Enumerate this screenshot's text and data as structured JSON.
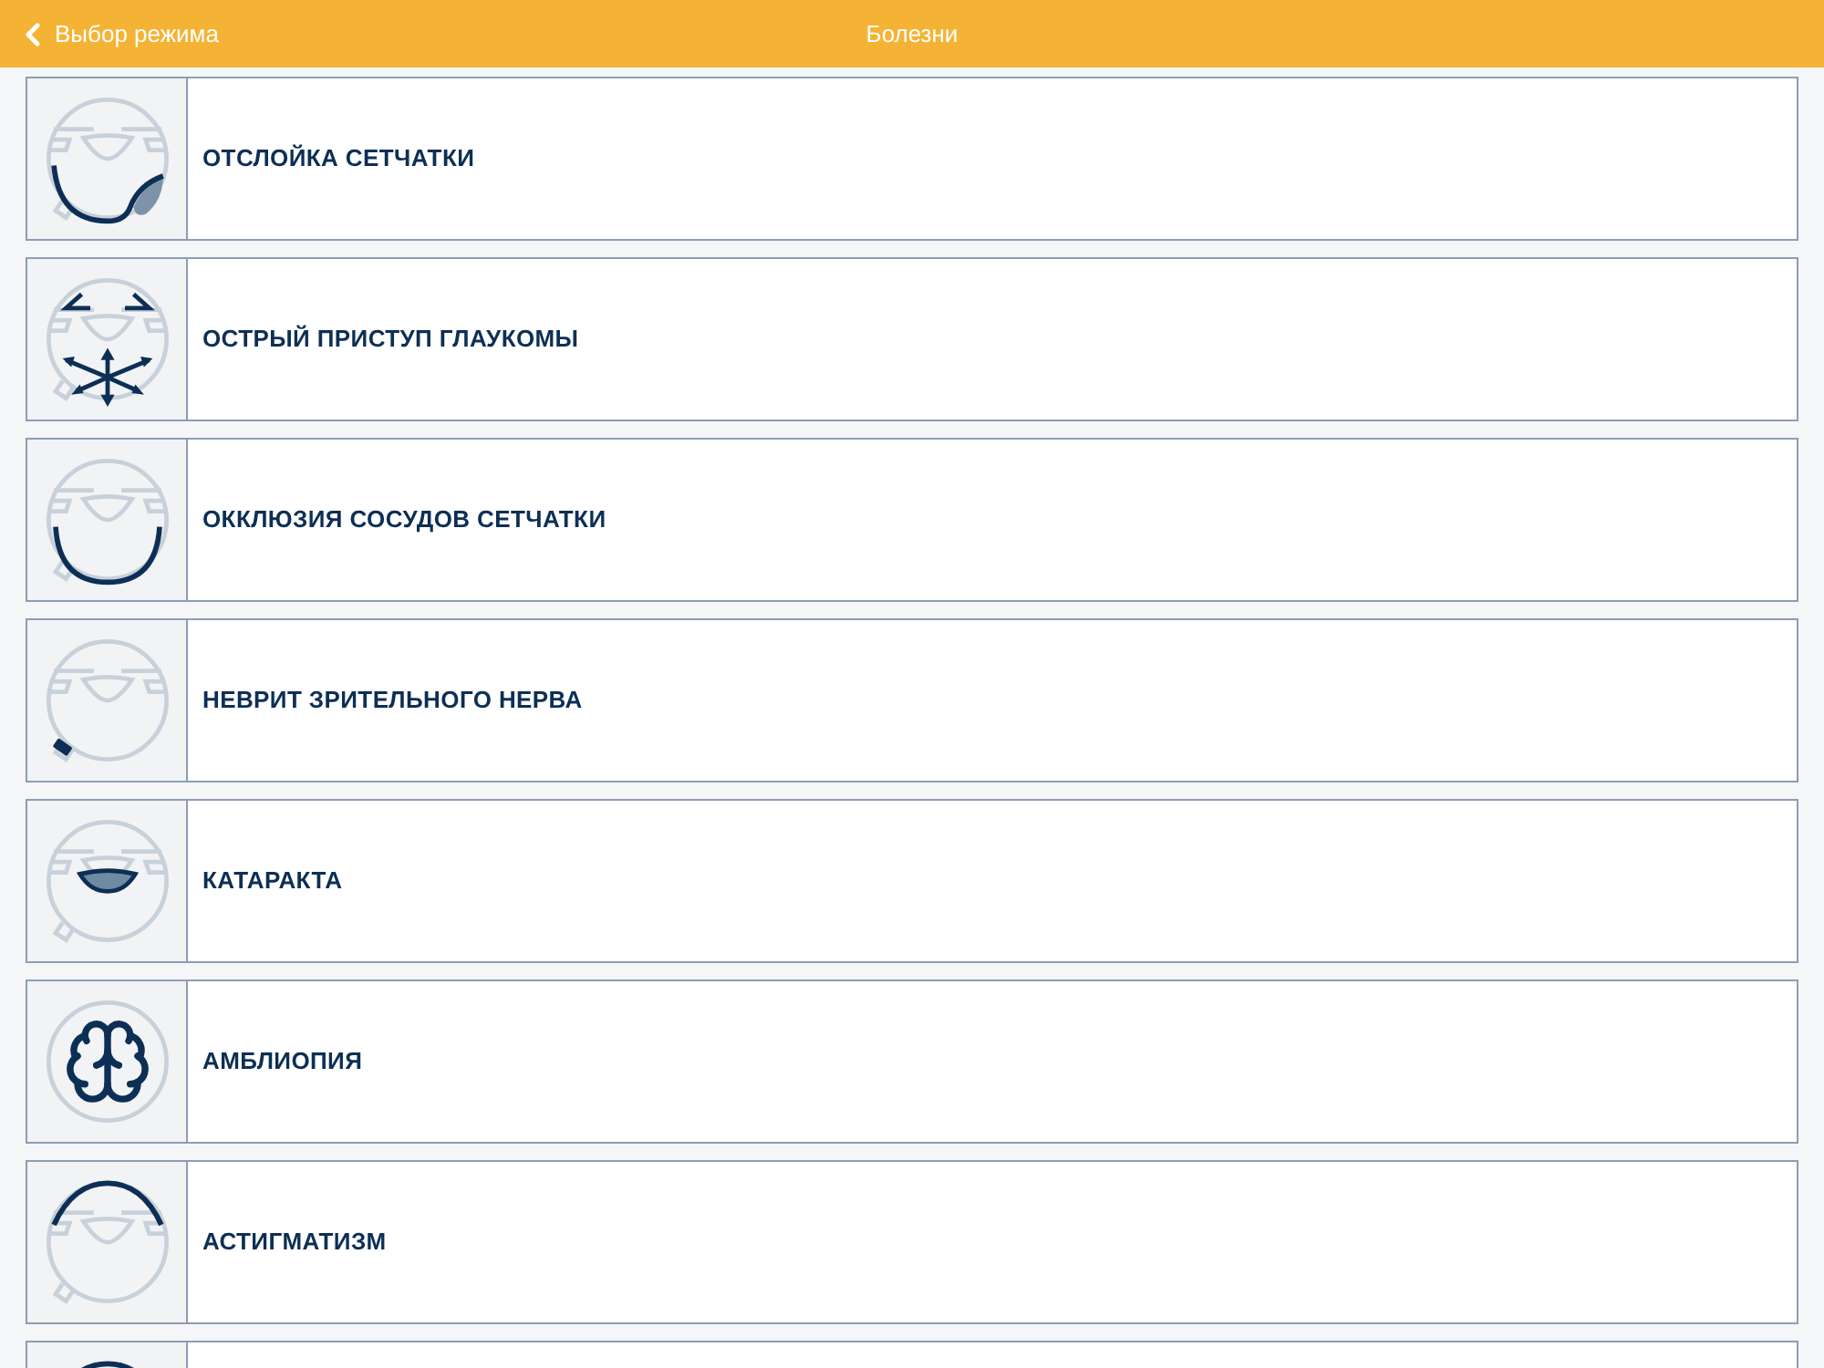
{
  "header": {
    "back_label": "Выбор режима",
    "title": "Болезни"
  },
  "diseases": [
    {
      "title": "ОТСЛОЙКА СЕТЧАТКИ",
      "kind": "detachment"
    },
    {
      "title": "ОСТРЫЙ ПРИСТУП ГЛАУКОМЫ",
      "kind": "glaucoma"
    },
    {
      "title": "ОККЛЮЗИЯ СОСУДОВ СЕТЧАТКИ",
      "kind": "occlusion"
    },
    {
      "title": "НЕВРИТ ЗРИТЕЛЬНОГО НЕРВА",
      "kind": "neuritis"
    },
    {
      "title": "КАТАРАКТА",
      "kind": "cataract"
    },
    {
      "title": "АМБЛИОПИЯ",
      "kind": "brain"
    },
    {
      "title": "АСТИГМАТИЗМ",
      "kind": "astigmatism"
    },
    {
      "kind": "astigmatism"
    }
  ]
}
